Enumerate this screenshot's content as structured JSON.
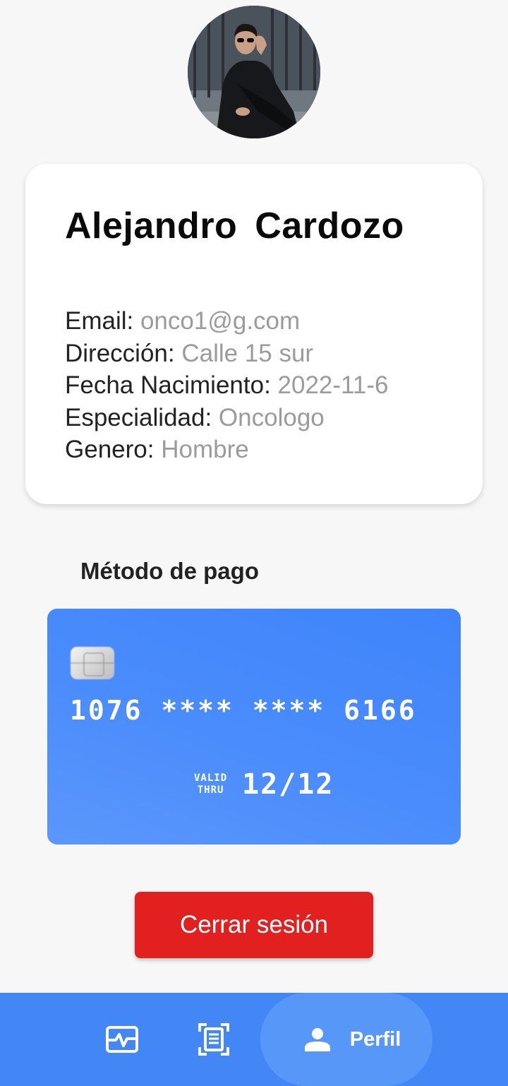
{
  "profile": {
    "name": "Alejandro  Cardozo",
    "fields": [
      {
        "label": "Email: ",
        "value": "onco1@g.com"
      },
      {
        "label": "Dirección: ",
        "value": "Calle 15 sur"
      },
      {
        "label": "Fecha Nacimiento: ",
        "value": "2022-11-6"
      },
      {
        "label": "Especialidad: ",
        "value": "Oncologo"
      },
      {
        "label": "Genero: ",
        "value": "Hombre"
      }
    ]
  },
  "payment": {
    "title": "Método de pago",
    "card_number": "1076 **** **** 6166",
    "valid_line1": "VALID",
    "valid_line2": "THRU",
    "expiry": "12/12"
  },
  "actions": {
    "logout_label": "Cerrar sesión"
  },
  "nav": {
    "items": [
      {
        "icon": "activity-icon",
        "label": ""
      },
      {
        "icon": "document-scan-icon",
        "label": ""
      },
      {
        "icon": "person-icon",
        "label": "Perfil"
      }
    ],
    "active_index": 2
  },
  "colors": {
    "accent": "#4287f5",
    "danger": "#e2201f",
    "muted_text": "#9b9b9b"
  }
}
